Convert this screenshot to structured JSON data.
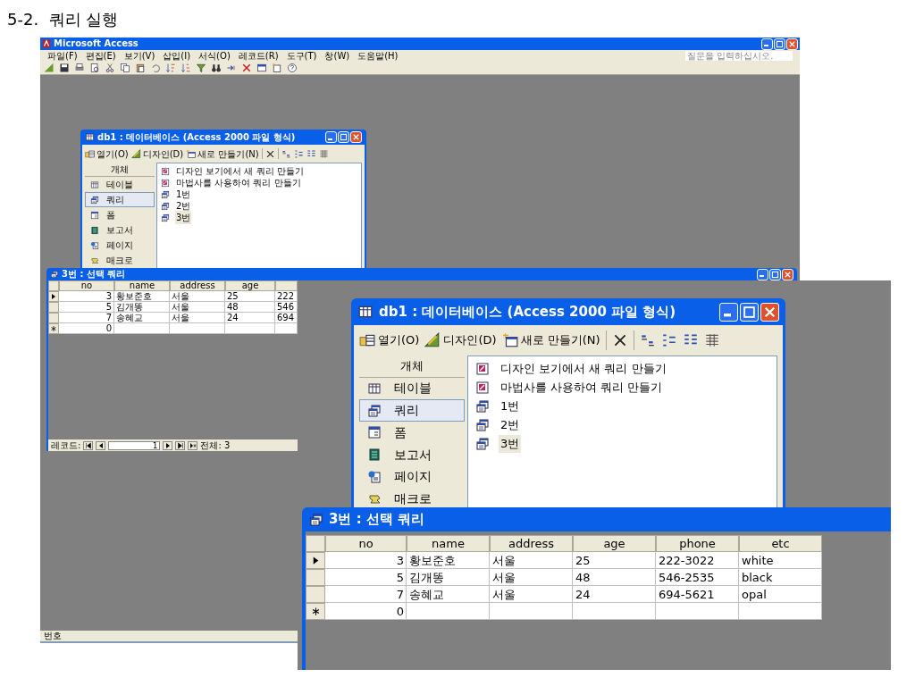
{
  "heading": "5-2.  쿼리 실행",
  "background_screenshot": {
    "app_title": "Microsoft Access",
    "menu": [
      "파일(F)",
      "편집(E)",
      "보기(V)",
      "삽입(I)",
      "서식(O)",
      "레코드(R)",
      "도구(T)",
      "창(W)",
      "도움말(H)"
    ],
    "help_placeholder": "질문을 입력하십시오.",
    "db_window": {
      "title": "db1 : 데이터베이스 (Access 2000 파일 형식)",
      "toolbar": [
        "열기(O)",
        "디자인(D)",
        "새로 만들기(N)"
      ],
      "objects_header": "개체",
      "objects": [
        {
          "label": "테이블",
          "kind": "table",
          "selected": false
        },
        {
          "label": "쿼리",
          "kind": "query",
          "selected": true
        },
        {
          "label": "폼",
          "kind": "form",
          "selected": false
        },
        {
          "label": "보고서",
          "kind": "report",
          "selected": false
        },
        {
          "label": "페이지",
          "kind": "page",
          "selected": false
        },
        {
          "label": "매크로",
          "kind": "macro",
          "selected": false
        }
      ],
      "items": [
        {
          "label": "디자인 보기에서 새 쿼리 만들기",
          "kind": "wizard",
          "selected": false
        },
        {
          "label": "마법사를 사용하여 쿼리 만들기",
          "kind": "wizard",
          "selected": false
        },
        {
          "label": "1번",
          "kind": "query",
          "selected": false
        },
        {
          "label": "2번",
          "kind": "query",
          "selected": false
        },
        {
          "label": "3번",
          "kind": "query",
          "selected": true
        }
      ]
    },
    "query_window": {
      "title": "3번 : 선택 쿼리",
      "columns": [
        "no",
        "name",
        "address",
        "age"
      ],
      "rows": [
        {
          "kind": "current",
          "values": [
            "3",
            "황보준호",
            "서울",
            "25",
            "222"
          ]
        },
        {
          "kind": "normal",
          "values": [
            "5",
            "김개똥",
            "서울",
            "48",
            "546"
          ]
        },
        {
          "kind": "normal",
          "values": [
            "7",
            "송혜교",
            "서울",
            "24",
            "694"
          ]
        },
        {
          "kind": "new",
          "values": [
            "0"
          ]
        }
      ],
      "record_nav": {
        "label": "레코드:",
        "current": "1",
        "total": "전체: 3"
      }
    },
    "status_text": "번호"
  },
  "zoomed_db_window": {
    "title": "db1 : 데이터베이스 (Access 2000 파일 형식)",
    "toolbar": [
      "열기(O)",
      "디자인(D)",
      "새로 만들기(N)"
    ],
    "objects_header": "개체",
    "objects": [
      {
        "label": "테이블",
        "kind": "table",
        "selected": false
      },
      {
        "label": "쿼리",
        "kind": "query",
        "selected": true
      },
      {
        "label": "폼",
        "kind": "form",
        "selected": false
      },
      {
        "label": "보고서",
        "kind": "report",
        "selected": false
      },
      {
        "label": "페이지",
        "kind": "page",
        "selected": false
      },
      {
        "label": "매크로",
        "kind": "macro",
        "selected": false
      }
    ],
    "items": [
      {
        "label": "디자인 보기에서 새 쿼리 만들기",
        "kind": "wizard",
        "selected": false
      },
      {
        "label": "마법사를 사용하여 쿼리 만들기",
        "kind": "wizard",
        "selected": false
      },
      {
        "label": "1번",
        "kind": "query",
        "selected": false
      },
      {
        "label": "2번",
        "kind": "query",
        "selected": false
      },
      {
        "label": "3번",
        "kind": "query",
        "selected": true
      }
    ]
  },
  "zoomed_query_window": {
    "title": "3번 : 선택 쿼리",
    "columns": [
      "no",
      "name",
      "address",
      "age",
      "phone",
      "etc"
    ],
    "rows": [
      {
        "kind": "current",
        "values": [
          "3",
          "황보준호",
          "서울",
          "25",
          "222-3022",
          "white"
        ]
      },
      {
        "kind": "normal",
        "values": [
          "5",
          "김개똥",
          "서울",
          "48",
          "546-2535",
          "black"
        ]
      },
      {
        "kind": "normal",
        "values": [
          "7",
          "송혜교",
          "서울",
          "24",
          "694-5621",
          "opal"
        ]
      },
      {
        "kind": "new",
        "values": [
          "0"
        ]
      }
    ]
  }
}
